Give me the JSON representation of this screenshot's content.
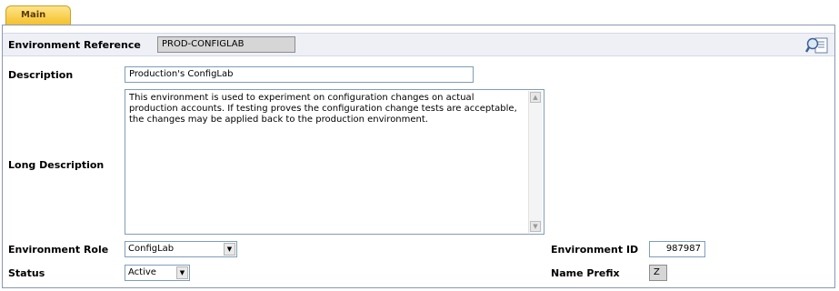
{
  "tabs": [
    {
      "label": "Main"
    }
  ],
  "form": {
    "environment_reference": {
      "label": "Environment Reference",
      "value": "PROD-CONFIGLAB"
    },
    "description": {
      "label": "Description",
      "value": "Production's ConfigLab"
    },
    "long_description": {
      "label": "Long Description",
      "value": "This environment is used to experiment on configuration changes on actual production accounts.  If testing proves the configuration change tests are acceptable, the changes may be applied back to the production environment."
    },
    "environment_role": {
      "label": "Environment Role",
      "value": "ConfigLab"
    },
    "status": {
      "label": "Status",
      "value": "Active"
    },
    "environment_id": {
      "label": "Environment ID",
      "value": "987987"
    },
    "name_prefix": {
      "label": "Name Prefix",
      "value": "Z"
    }
  },
  "icons": {
    "lookup": "search-document-icon",
    "dropdown": "triangle-down-icon"
  },
  "colors": {
    "tab_active": "#f5c12c",
    "ref_bar": "#eef0f6",
    "border": "#8a98b5",
    "readonly_field": "#d6d6d6"
  }
}
